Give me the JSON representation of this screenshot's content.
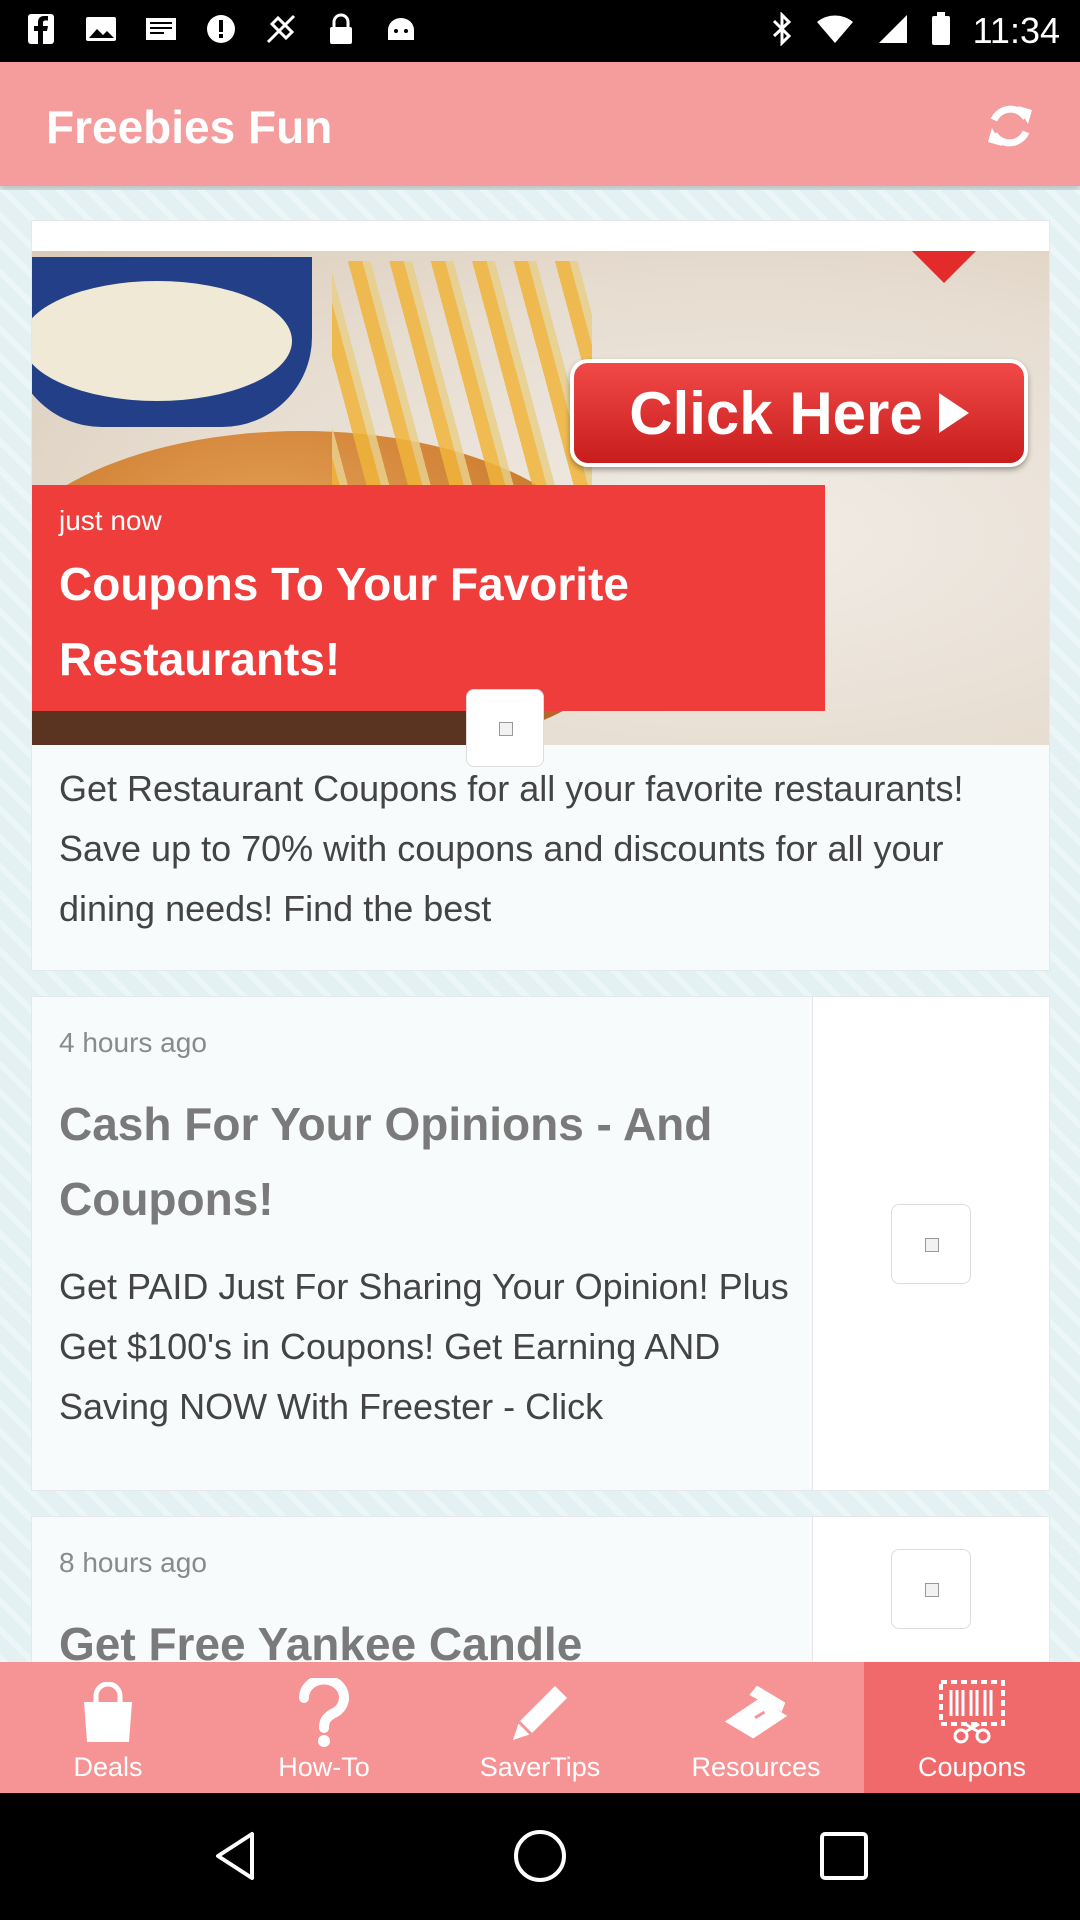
{
  "status_bar": {
    "time": "11:34",
    "left_icons": [
      "facebook-icon",
      "image-icon",
      "mail-icon",
      "alert-icon",
      "fake-gps-icon",
      "lock-icon",
      "android-icon"
    ],
    "right_icons": [
      "bluetooth-icon",
      "wifi-icon",
      "signal-icon",
      "battery-icon"
    ]
  },
  "app_bar": {
    "title": "Freebies Fun",
    "refresh_icon": "refresh-icon"
  },
  "feed": [
    {
      "time": "just now",
      "title": "Coupons To Your Favorite Restaurants!",
      "body": "Get Restaurant Coupons for all your favorite restaurants! Save up to 70% with coupons and discounts for all your dining needs! Find the best",
      "image_button": "Click Here"
    },
    {
      "time": "4 hours ago",
      "title": "Cash For Your Opinions - And Coupons!",
      "body": "Get PAID Just For Sharing Your Opinion! Plus Get $100's in Coupons! Get Earning AND Saving NOW With Freester - Click"
    },
    {
      "time": "8 hours ago",
      "title": "Get Free Yankee Candle"
    }
  ],
  "bottom_nav": [
    {
      "label": "Deals",
      "icon": "shopping-bag-icon",
      "active": false
    },
    {
      "label": "How-To",
      "icon": "question-icon",
      "active": false
    },
    {
      "label": "SaverTips",
      "icon": "pencil-icon",
      "active": false
    },
    {
      "label": "Resources",
      "icon": "laptop-icon",
      "active": false
    },
    {
      "label": "Coupons",
      "icon": "coupon-scissors-icon",
      "active": true
    }
  ],
  "system_nav": [
    "back-icon",
    "home-icon",
    "recents-icon"
  ],
  "colors": {
    "app_bar": "#f59c9d",
    "banner_red": "#ee3d3a",
    "nav_bg": "#f69495",
    "nav_active": "#f06a6c"
  }
}
